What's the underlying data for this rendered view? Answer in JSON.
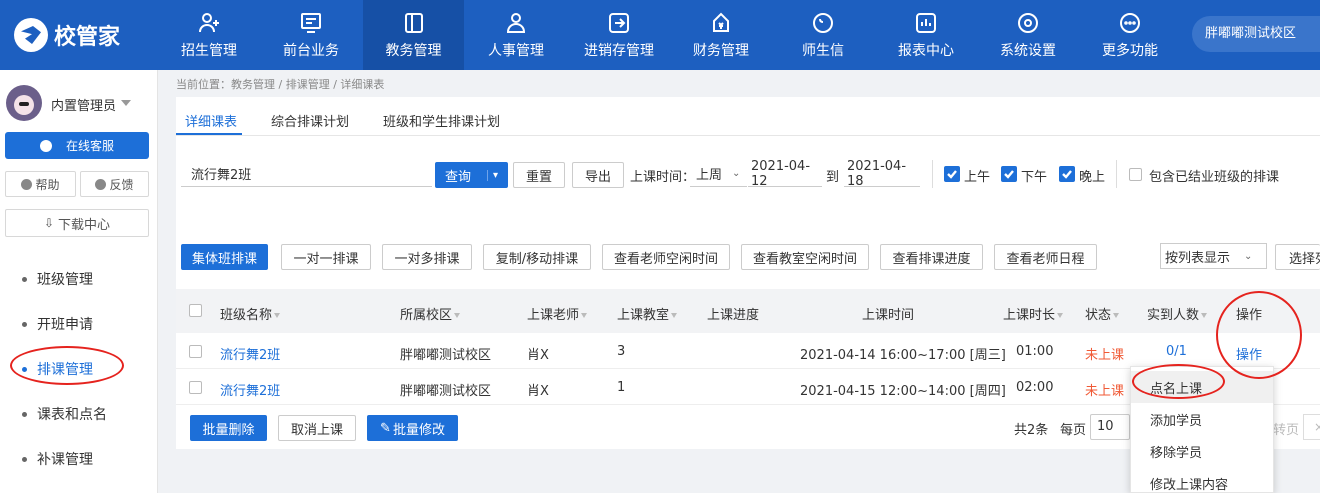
{
  "app": {
    "logo_text": "校管家",
    "school": "胖嘟嘟测试校区"
  },
  "nav": [
    {
      "label": "招生管理",
      "icon": "add-user-icon"
    },
    {
      "label": "前台业务",
      "icon": "monitor-icon"
    },
    {
      "label": "教务管理",
      "icon": "book-icon",
      "active": true
    },
    {
      "label": "人事管理",
      "icon": "person-icon"
    },
    {
      "label": "进销存管理",
      "icon": "arrow-box-icon"
    },
    {
      "label": "财务管理",
      "icon": "money-bag-icon"
    },
    {
      "label": "师生信",
      "icon": "chat-icon"
    },
    {
      "label": "报表中心",
      "icon": "bar-chart-icon"
    },
    {
      "label": "系统设置",
      "icon": "gear-icon"
    },
    {
      "label": "更多功能",
      "icon": "more-icon"
    }
  ],
  "sidebar": {
    "user": "内置管理员",
    "service": "在线客服",
    "help": "帮助",
    "feedback": "反馈",
    "download": "下载中心",
    "items": [
      {
        "label": "班级管理"
      },
      {
        "label": "开班申请"
      },
      {
        "label": "排课管理",
        "active": true
      },
      {
        "label": "课表和点名"
      },
      {
        "label": "补课管理"
      }
    ]
  },
  "breadcrumb": "当前位置：教务管理 / 排课管理 / 详细课表",
  "tabs": [
    "详细课表",
    "综合排课计划",
    "班级和学生排课计划"
  ],
  "filters": {
    "class_value": "流行舞2班",
    "query": "查询",
    "reset": "重置",
    "export": "导出",
    "time_label": "上课时间：",
    "period": "上周",
    "date_from": "2021-04-12",
    "to": "到",
    "date_to": "2021-04-18",
    "morning": "上午",
    "afternoon": "下午",
    "evening": "晚上",
    "include_finished": "包含已结业班级的排课"
  },
  "actions": [
    "集体班排课",
    "一对一排课",
    "一对多排课",
    "复制/移动排课",
    "查看老师空闲时间",
    "查看教室空闲时间",
    "查看排课进度",
    "查看老师日程"
  ],
  "view_select": "按列表显示",
  "select_columns": "选择列",
  "table": {
    "headers": {
      "name": "班级名称",
      "campus": "所属校区",
      "teacher": "上课老师",
      "room": "上课教室",
      "progress": "上课进度",
      "time": "上课时间",
      "duration": "上课时长",
      "status": "状态",
      "attendance": "实到人数",
      "ops": "操作"
    },
    "rows": [
      {
        "name": "流行舞2班",
        "campus": "胖嘟嘟测试校区",
        "teacher": "肖X",
        "room": "3",
        "time": "2021-04-14 16:00~17:00 [周三]",
        "duration": "01:00",
        "status": "未上课",
        "attendance": "0/1",
        "op": "操作"
      },
      {
        "name": "流行舞2班",
        "campus": "胖嘟嘟测试校区",
        "teacher": "肖X",
        "room": "1",
        "time": "2021-04-15 12:00~14:00 [周四]",
        "duration": "02:00",
        "status": "未上课",
        "attendance": "",
        "op": ""
      }
    ]
  },
  "bottom": {
    "batch_delete": "批量删除",
    "cancel_class": "取消上课",
    "batch_edit": "批量修改"
  },
  "pagination": {
    "total": "共2条",
    "per_page": "每页",
    "size": "10",
    "goto": "转页"
  },
  "dropdown": [
    "点名上课",
    "添加学员",
    "移除学员",
    "修改上课内容"
  ],
  "colors": {
    "primary": "#1d6fd8",
    "nav": "#1d5fc0",
    "status_red": "#f05a36",
    "annotation": "#e5231e"
  }
}
